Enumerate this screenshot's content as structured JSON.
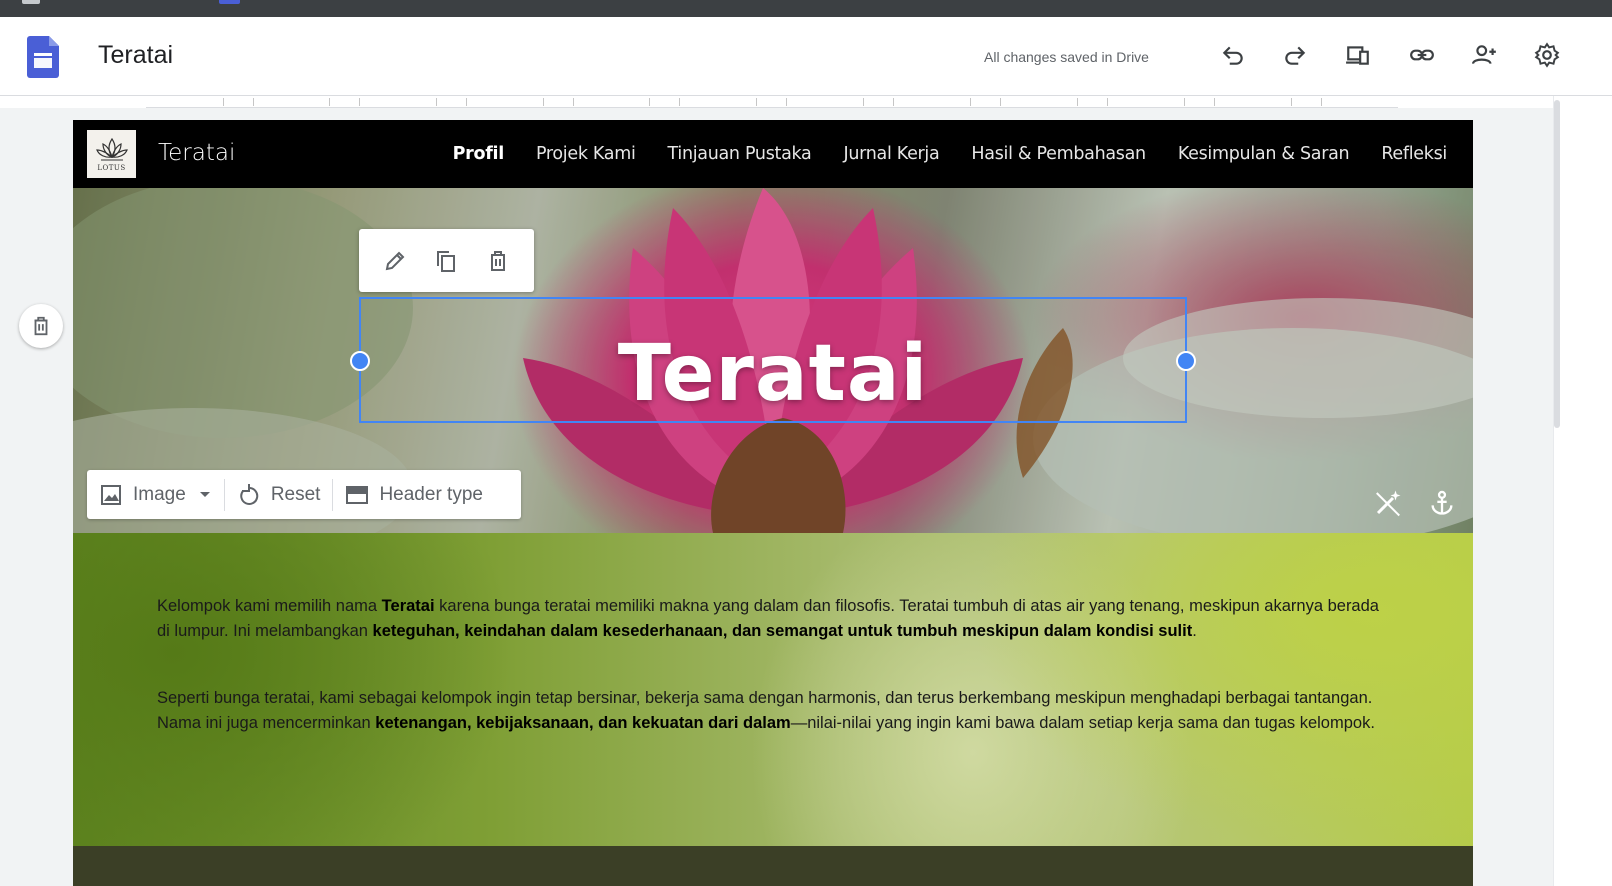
{
  "app": {
    "title": "Teratai",
    "save_status": "All changes saved in Drive",
    "toolbar_icons": [
      "undo-icon",
      "redo-icon",
      "preview-icon",
      "link-icon",
      "share-icon",
      "settings-icon"
    ]
  },
  "site": {
    "name": "Teratai",
    "logo_text": "LOTUS",
    "nav": [
      {
        "label": "Profil",
        "active": true
      },
      {
        "label": "Projek Kami",
        "active": false
      },
      {
        "label": "Tinjauan Pustaka",
        "active": false
      },
      {
        "label": "Jurnal Kerja",
        "active": false
      },
      {
        "label": "Hasil & Pembahasan",
        "active": false
      },
      {
        "label": "Kesimpulan & Saran",
        "active": false
      },
      {
        "label": "Refleksi",
        "active": false
      }
    ]
  },
  "hero": {
    "title": "Teratai",
    "toolbar": {
      "image_label": "Image",
      "reset_label": "Reset",
      "header_type_label": "Header type"
    }
  },
  "content": {
    "p1": {
      "t1": "Kelompok kami memilih nama ",
      "b1": "Teratai",
      "t2": " karena bunga teratai memiliki makna yang dalam dan filosofis. Teratai tumbuh di atas air yang tenang, meskipun akarnya berada di lumpur. Ini melambangkan ",
      "b2": "keteguhan, keindahan dalam kesederhanaan, dan semangat untuk tumbuh meskipun dalam kondisi sulit",
      "t3": "."
    },
    "p2": {
      "t1": "Seperti bunga teratai, kami sebagai kelompok ingin tetap bersinar, bekerja sama dengan harmonis, dan terus berkembang meskipun menghadapi berbagai tantangan. Nama ini juga mencerminkan ",
      "b1": "ketenangan, kebijaksanaan, dan kekuatan dari dalam",
      "t2": "—nilai-nilai yang ingin kami bawa dalam setiap kerja sama dan tugas kelompok."
    }
  },
  "colors": {
    "accent": "#4285f4",
    "sites_logo": "#4a5fd6",
    "nav_bg": "#000000"
  }
}
